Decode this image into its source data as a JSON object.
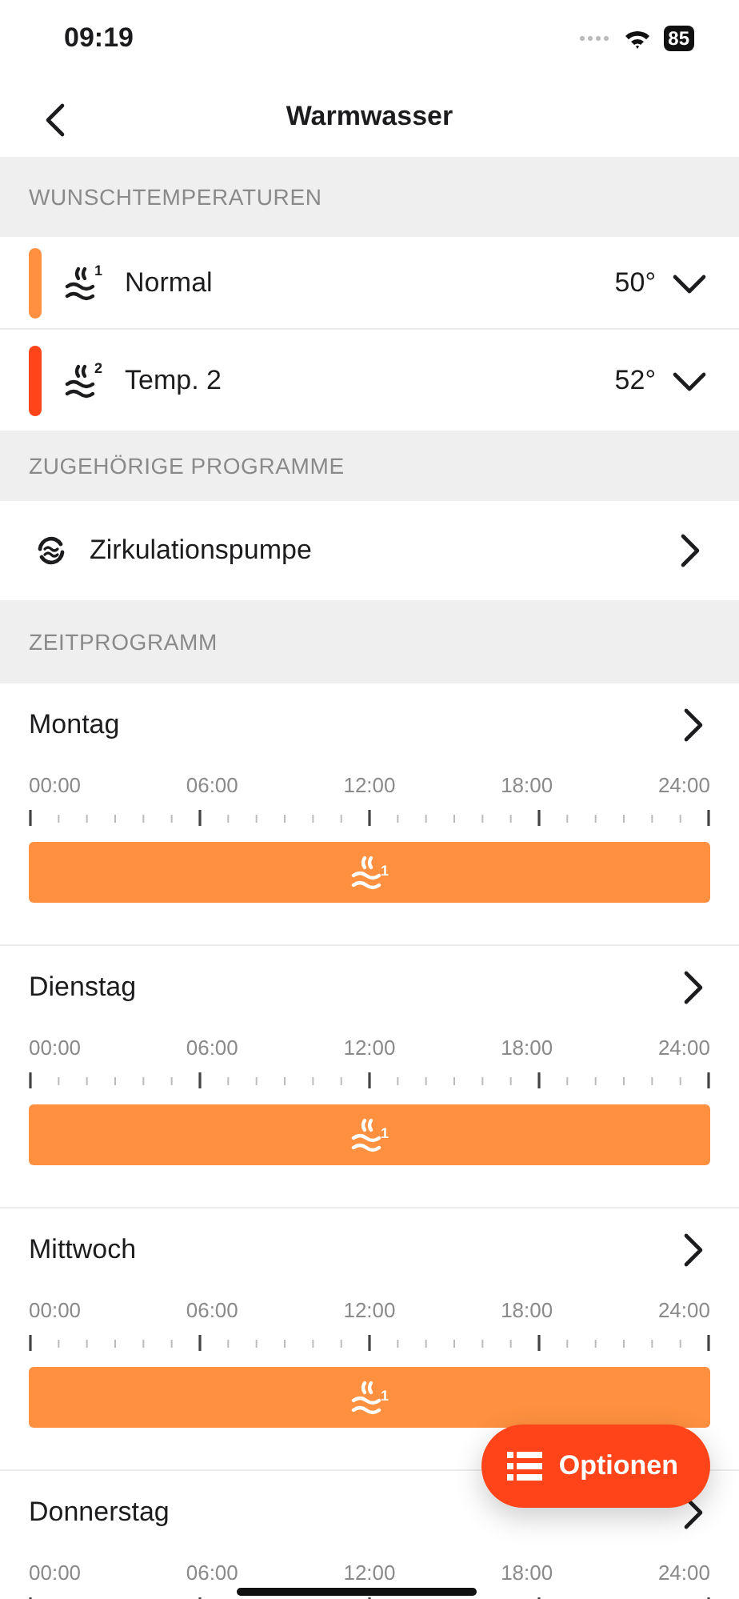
{
  "status_bar": {
    "time": "09:19",
    "battery": "85"
  },
  "nav": {
    "title": "Warmwasser"
  },
  "sections": [
    {
      "kind": "temps",
      "title": "WUNSCHTEMPERATUREN",
      "items": [
        {
          "index": "1",
          "label": "Normal",
          "value": "50°",
          "color": "#ff9040"
        },
        {
          "index": "2",
          "label": "Temp. 2",
          "value": "52°",
          "color": "#ff4419"
        }
      ]
    },
    {
      "kind": "links",
      "title": "ZUGEHÖRIGE PROGRAMME",
      "items": [
        {
          "label": "Zirkulationspumpe"
        }
      ]
    },
    {
      "kind": "schedule",
      "title": "ZEITPROGRAMM",
      "days": [
        {
          "name": "Montag",
          "ticks": [
            "00:00",
            "06:00",
            "12:00",
            "18:00",
            "24:00"
          ],
          "segments": [
            {
              "index": "1",
              "color": "#ff9040"
            }
          ]
        },
        {
          "name": "Dienstag",
          "ticks": [
            "00:00",
            "06:00",
            "12:00",
            "18:00",
            "24:00"
          ],
          "segments": [
            {
              "index": "1",
              "color": "#ff9040"
            }
          ]
        },
        {
          "name": "Mittwoch",
          "ticks": [
            "00:00",
            "06:00",
            "12:00",
            "18:00",
            "24:00"
          ],
          "segments": [
            {
              "index": "1",
              "color": "#ff9040"
            }
          ]
        },
        {
          "name": "Donnerstag",
          "ticks": [
            "00:00",
            "06:00",
            "12:00",
            "18:00",
            "24:00"
          ]
        }
      ]
    }
  ],
  "fab": {
    "label": "Optionen"
  }
}
